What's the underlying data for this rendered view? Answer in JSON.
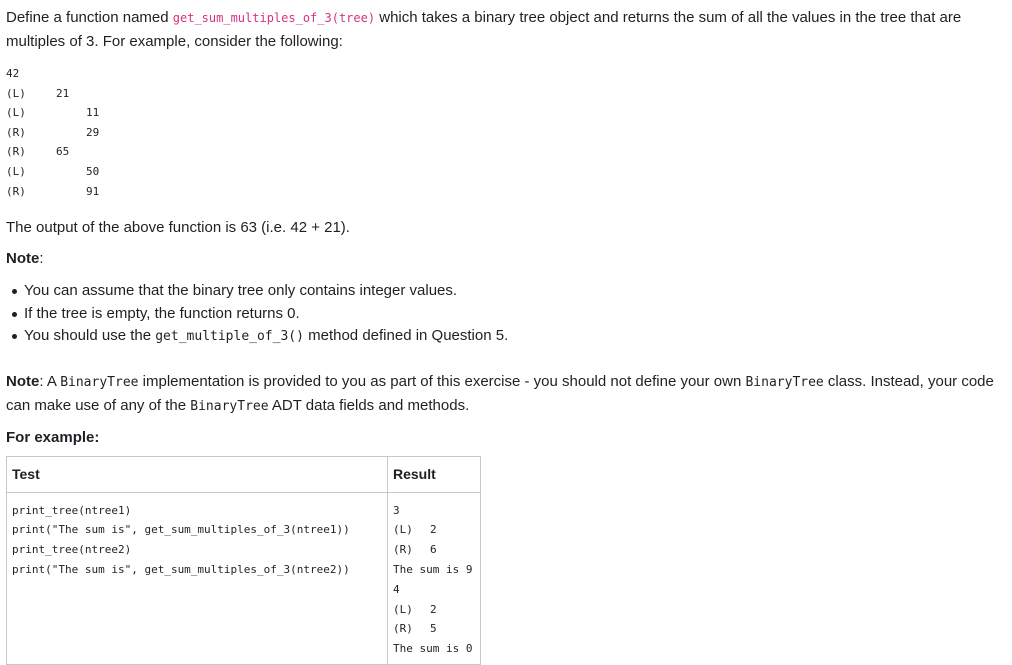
{
  "intro": {
    "pre": "Define a function named ",
    "fn": "get_sum_multiples_of_3(tree)",
    "post": " which takes a binary tree object and returns the sum of all the values in the tree that are multiples of 3. For example, consider the following:"
  },
  "tree_rows": [
    [
      "42",
      "",
      ""
    ],
    [
      "(L)",
      "21",
      ""
    ],
    [
      "(L)",
      "",
      "11"
    ],
    [
      "(R)",
      "",
      "29"
    ],
    [
      "(R)",
      "65",
      ""
    ],
    [
      "(L)",
      "",
      "50"
    ],
    [
      "(R)",
      "",
      "91"
    ]
  ],
  "output_text": "The output of the above function is 63 (i.e. 42 + 21).",
  "note1": {
    "label": "Note",
    "colon": ":"
  },
  "bullets": {
    "b1": "You can assume that the binary tree only contains integer values.",
    "b2": "If the tree is empty, the function returns 0.",
    "b3_pre": "You should use the ",
    "b3_code": "get_multiple_of_3()",
    "b3_post": " method defined in Question 5."
  },
  "note2": {
    "label": "Note",
    "t1": ": A ",
    "c1": "BinaryTree",
    "t2": " implementation is provided to you as part of this exercise - you should not define your own ",
    "c2": "BinaryTree",
    "t3": " class. Instead, your code can make use of any of the ",
    "c3": "BinaryTree",
    "t4": " ADT data fields and methods."
  },
  "for_example": "For example:",
  "table": {
    "headers": {
      "test": "Test",
      "result": "Result"
    },
    "test_lines": [
      "print_tree(ntree1)",
      "print(\"The sum is\", get_sum_multiples_of_3(ntree1))",
      "print_tree(ntree2)",
      "print(\"The sum is\", get_sum_multiples_of_3(ntree2))"
    ],
    "result_rows": [
      [
        "3",
        ""
      ],
      [
        "(L)",
        "2"
      ],
      [
        "(R)",
        "6"
      ],
      [
        "The sum is 9",
        ""
      ],
      [
        "4",
        ""
      ],
      [
        "(L)",
        "2"
      ],
      [
        "(R)",
        "5"
      ],
      [
        "The sum is 0",
        ""
      ]
    ]
  }
}
